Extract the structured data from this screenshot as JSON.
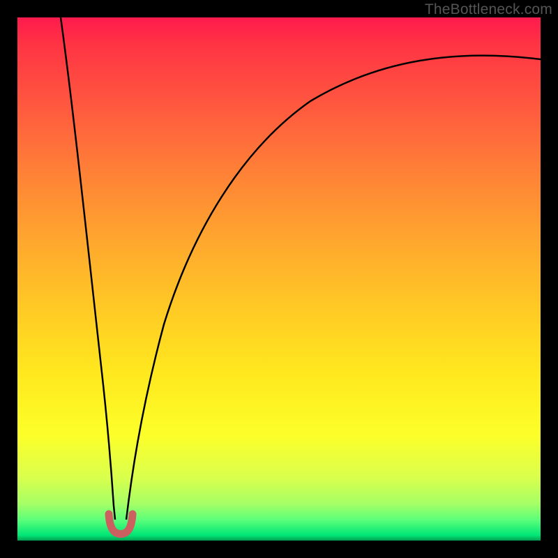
{
  "watermark": "TheBottleneck.com",
  "chart_data": {
    "type": "line",
    "title": "",
    "xlabel": "",
    "ylabel": "",
    "xlim": [
      0,
      100
    ],
    "ylim": [
      0,
      100
    ],
    "grid": false,
    "background_gradient": {
      "bottom_color": "#00e676",
      "top_color": "#ff1a4d",
      "stops": [
        "green",
        "yellow",
        "orange",
        "red"
      ]
    },
    "series": [
      {
        "name": "bottleneck-curve-left",
        "type": "line",
        "color": "#000000",
        "x": [
          8,
          10,
          12,
          14,
          16,
          17,
          18,
          18.5
        ],
        "y": [
          100,
          78,
          58,
          40,
          22,
          12,
          5,
          2
        ]
      },
      {
        "name": "bottleneck-curve-right",
        "type": "line",
        "color": "#000000",
        "x": [
          20.5,
          22,
          25,
          30,
          37,
          45,
          55,
          67,
          80,
          100
        ],
        "y": [
          2,
          10,
          25,
          42,
          58,
          70,
          78,
          85,
          89,
          92
        ]
      },
      {
        "name": "optimal-zone-marker",
        "type": "line",
        "color": "#cc5f5f",
        "stroke_width": 10,
        "x": [
          17.5,
          18,
          19,
          19.5,
          20,
          21,
          21.5
        ],
        "y": [
          5,
          2,
          1,
          1,
          1,
          2,
          5
        ]
      }
    ],
    "optimal_x": 19.5,
    "annotations": []
  }
}
